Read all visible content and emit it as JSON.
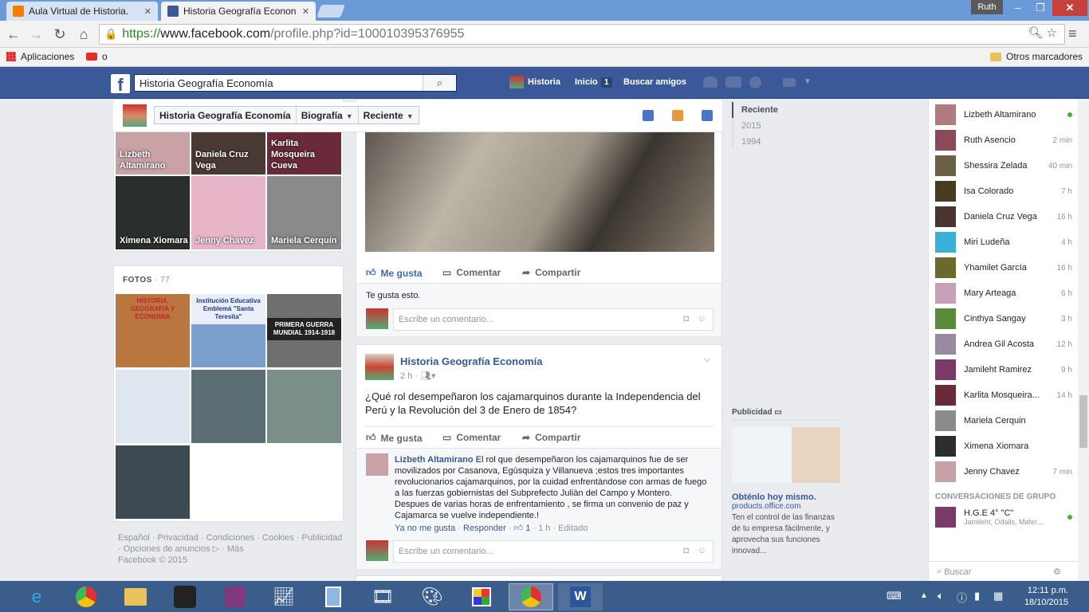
{
  "browser": {
    "tabs": [
      {
        "title": "Aula Virtual de Historia.",
        "close": "✕"
      },
      {
        "title": "Historia Geografía Econon",
        "close": "✕"
      }
    ],
    "user": "Ruth",
    "window_buttons": [
      "‒",
      "❐",
      "✕"
    ],
    "url_scheme": "https://",
    "url_host": "www.facebook.com",
    "url_path": "/profile.php?id=100010395376955",
    "bookmarks": [
      "Aplicaciones",
      "o"
    ],
    "other_bookmarks": "Otros marcadores"
  },
  "fb": {
    "logo": "f",
    "search_value": "Historia Geografía Economía",
    "nav": {
      "profile": "Historia",
      "home": "Inicio",
      "home_count": "1",
      "find_friends": "Buscar amigos"
    },
    "crumbs": [
      "Historia Geografía Economía",
      "Biografía",
      "Reciente"
    ]
  },
  "friends": [
    {
      "name": "Lizbeth Altamirano",
      "color": "#c9a2a6"
    },
    {
      "name": "Daniela Cruz Vega",
      "color": "#4a3a34"
    },
    {
      "name": "Karlita Mosqueira Cueva",
      "color": "#6a2a3a"
    },
    {
      "name": "Ximena Xiomara",
      "color": "#2b2f2b"
    },
    {
      "name": "Jenny Chavez",
      "color": "#e8b5c8"
    },
    {
      "name": "Mariela Cerquín",
      "color": "#8a8a8a"
    }
  ],
  "photos": {
    "title": "FOTOS",
    "count": "77",
    "tiles": [
      {
        "caption": "HISTORIA, GEOGRAFIA Y ECONOMIA",
        "color": "#b9763f"
      },
      {
        "caption": "Institución Educativa Emblemá \"Santa Teresita\"",
        "color": "#7a9fcc"
      },
      {
        "caption": "PRIMERA GUERRA MUNDIAL 1914-1918",
        "color": "#6f6f6f"
      },
      {
        "caption": "",
        "color": "#dfe6f0"
      },
      {
        "caption": "",
        "color": "#5a6e74"
      },
      {
        "caption": "",
        "color": "#7a8e8a"
      },
      {
        "caption": "",
        "color": "#3d4a52"
      }
    ]
  },
  "footer": {
    "links": [
      "Español",
      "Privacidad",
      "Condiciones",
      "Cookies",
      "Publicidad",
      "Opciones de anuncios",
      "Más"
    ],
    "copyright": "Facebook © 2015"
  },
  "post1": {
    "like": "Me gusta",
    "comment": "Comentar",
    "share": "Compartir",
    "likes_text": "Te gusta esto.",
    "comment_placeholder": "Escribe un comentario..."
  },
  "post2": {
    "author": "Historia Geografía Economía",
    "time": "2 h",
    "text": "¿Qué rol desempeñaron los cajamarquinos durante la Independencia del Perú y la Revolución del 3 de Enero de 1854?",
    "like": "Me gusta",
    "comment": "Comentar",
    "share": "Compartir",
    "reply": {
      "author": "Lizbeth Altamirano",
      "text": "El rol que desempeñaron los cajamarquinos fue de ser movilizados por Casanova, Egùsquiza y Villanueva ;estos tres importantes revolucionarios cajamarquinos, por la cuidad enfrentàndose con armas de fuego a las fuerzas gobiernistas del Subprefecto Juliàn del Campo y Montero.",
      "text2": "Despues de varias horas de enfrentamiento , se firma un convenio de paz y Cajamarca se vuelve independiente.!",
      "unlike": "Ya no me gusta",
      "respond": "Responder",
      "likes": "1",
      "time": "1 h",
      "edited": "Editado"
    },
    "comment_placeholder": "Escribe un comentario..."
  },
  "timeline": [
    "Reciente",
    "2015",
    "1994"
  ],
  "ad": {
    "label": "Publicidad",
    "title": "Obténlo hoy mismo.",
    "domain": "products.office.com",
    "body": "Ten el control de las finanzas de tu empresa fácilmente, y aprovecha sus funciones innovad..."
  },
  "chat": {
    "contacts": [
      {
        "name": "Lizbeth Altamirano",
        "time": "",
        "online": true,
        "color": "#b07a7e"
      },
      {
        "name": "Ruth Asencio",
        "time": "2 min",
        "online": false,
        "color": "#8a4a5a"
      },
      {
        "name": "Shessira Zelada",
        "time": "40 min",
        "online": false,
        "color": "#6a6048"
      },
      {
        "name": "Isa Colorado",
        "time": "7 h",
        "online": false,
        "color": "#4a3a20"
      },
      {
        "name": "Daniela Cruz Vega",
        "time": "16 h",
        "online": false,
        "color": "#4a3430"
      },
      {
        "name": "Miri Ludeña",
        "time": "4 h",
        "online": false,
        "color": "#3ab0d8"
      },
      {
        "name": "Yhamilet García",
        "time": "16 h",
        "online": false,
        "color": "#6a6a2a"
      },
      {
        "name": "Mary Arteaga",
        "time": "6 h",
        "online": false,
        "color": "#c8a0b8"
      },
      {
        "name": "Cinthya Sangay",
        "time": "3 h",
        "online": false,
        "color": "#5a8a3a"
      },
      {
        "name": "Andrea Gil Acosta",
        "time": "12 h",
        "online": false,
        "color": "#9a8aa0"
      },
      {
        "name": "Jamileht Ramirez",
        "time": "9 h",
        "online": false,
        "color": "#7a3a6a"
      },
      {
        "name": "Karlita Mosqueira...",
        "time": "14 h",
        "online": false,
        "color": "#6a2a3a"
      },
      {
        "name": "Mariela Cerquin",
        "time": "",
        "online": false,
        "color": "#8a8a8a"
      },
      {
        "name": "Ximena Xiomara",
        "time": "",
        "online": false,
        "color": "#2b2f2b"
      },
      {
        "name": "Jenny Chavez",
        "time": "7 min",
        "online": false,
        "color": "#c8a0a8"
      }
    ],
    "group_title": "CONVERSACIONES DE GRUPO",
    "group_name": "H.G.E 4° \"C\"",
    "group_members": "Jamileht, Odalis, Mafer...",
    "search_placeholder": "Buscar"
  },
  "clock": {
    "time": "12:11 p.m.",
    "date": "18/10/2015"
  }
}
